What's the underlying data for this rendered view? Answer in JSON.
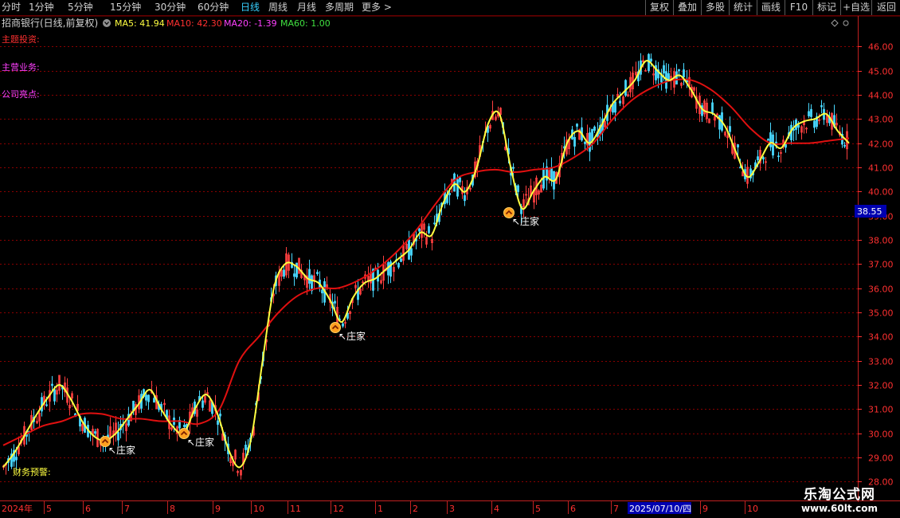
{
  "toolbar": {
    "periods": [
      "分时",
      "1分钟",
      "5分钟",
      "15分钟",
      "30分钟",
      "60分钟",
      "日线",
      "周线",
      "月线",
      "多周期",
      "更多"
    ],
    "active_period": "日线",
    "right_buttons": [
      "复权",
      "叠加",
      "多股",
      "统计",
      "画线",
      "F10",
      "标记",
      "+自选",
      "返回"
    ]
  },
  "header": {
    "stock": "招商银行(日线,前复权)",
    "ma5": "MA5: 41.94",
    "ma10": "MA10: 42.30",
    "ma20": "MA20: -1.39",
    "ma60": "MA60: 1.00"
  },
  "labels": {
    "theme": "主题投资:",
    "business": "主营业务:",
    "highlight": "公司亮点:",
    "finance": "财务预警:"
  },
  "signal_label": "庄家",
  "price_marker": "38.55",
  "date_marker": "2025/07/10/四",
  "colors": {
    "up": "#ff4040",
    "down": "#48d8ff",
    "ma5": "#ffff40",
    "ma10": "#e01010",
    "ma20": "#ff40ff",
    "ma60": "#40e040",
    "grid": "#8a0000",
    "axis": "#ff3030",
    "signal": "#ffa020"
  },
  "watermark": {
    "title": "乐淘公式网",
    "url": "www.60lt.com"
  },
  "chart_data": {
    "type": "candlestick",
    "y_ticks": [
      28.0,
      29.0,
      30.0,
      31.0,
      32.0,
      33.0,
      34.0,
      35.0,
      36.0,
      37.0,
      38.0,
      39.0,
      40.0,
      41.0,
      42.0,
      43.0,
      44.0,
      45.0,
      46.0
    ],
    "ylim": [
      27.55,
      46.6
    ],
    "x_labels": [
      "2024年",
      "5",
      "6",
      "7",
      "8",
      "9",
      "10",
      "11",
      "12",
      "1",
      "2",
      "3",
      "4",
      "5",
      "6",
      "7",
      "8",
      "9",
      "10"
    ],
    "ma_fast": [
      28.6,
      29.2,
      30.0,
      30.8,
      31.5,
      32.0,
      31.4,
      30.5,
      29.9,
      29.7,
      30.0,
      30.6,
      31.2,
      31.8,
      31.0,
      30.3,
      30.0,
      31.0,
      31.6,
      30.8,
      29.3,
      28.6,
      29.8,
      33.0,
      36.0,
      37.0,
      36.9,
      36.4,
      36.2,
      35.5,
      34.6,
      35.6,
      36.2,
      36.4,
      36.8,
      37.2,
      37.6,
      38.3,
      38.2,
      39.5,
      40.3,
      40.0,
      41.0,
      42.8,
      43.2,
      41.0,
      39.3,
      40.0,
      40.6,
      40.5,
      42.0,
      42.5,
      42.0,
      42.7,
      43.6,
      44.1,
      44.6,
      45.4,
      45.0,
      44.6,
      44.8,
      44.2,
      43.4,
      43.2,
      42.7,
      41.6,
      40.6,
      41.2,
      42.0,
      41.8,
      42.6,
      42.9,
      43.0,
      43.2,
      42.5,
      42.0
    ],
    "ma_slow": [
      29.5,
      29.9,
      30.3,
      30.5,
      30.8,
      30.8,
      30.6,
      30.6,
      30.5,
      30.5,
      30.4,
      31.0,
      33.0,
      34.0,
      35.0,
      35.7,
      36.0,
      36.0,
      36.3,
      36.8,
      37.5,
      38.4,
      39.5,
      40.5,
      40.8,
      40.9,
      40.8,
      40.9,
      41.0,
      41.4,
      42.0,
      43.0,
      43.8,
      44.3,
      44.6,
      44.6,
      44.2,
      43.5,
      42.6,
      42.0,
      42.0,
      42.0,
      42.1,
      42.2
    ]
  }
}
